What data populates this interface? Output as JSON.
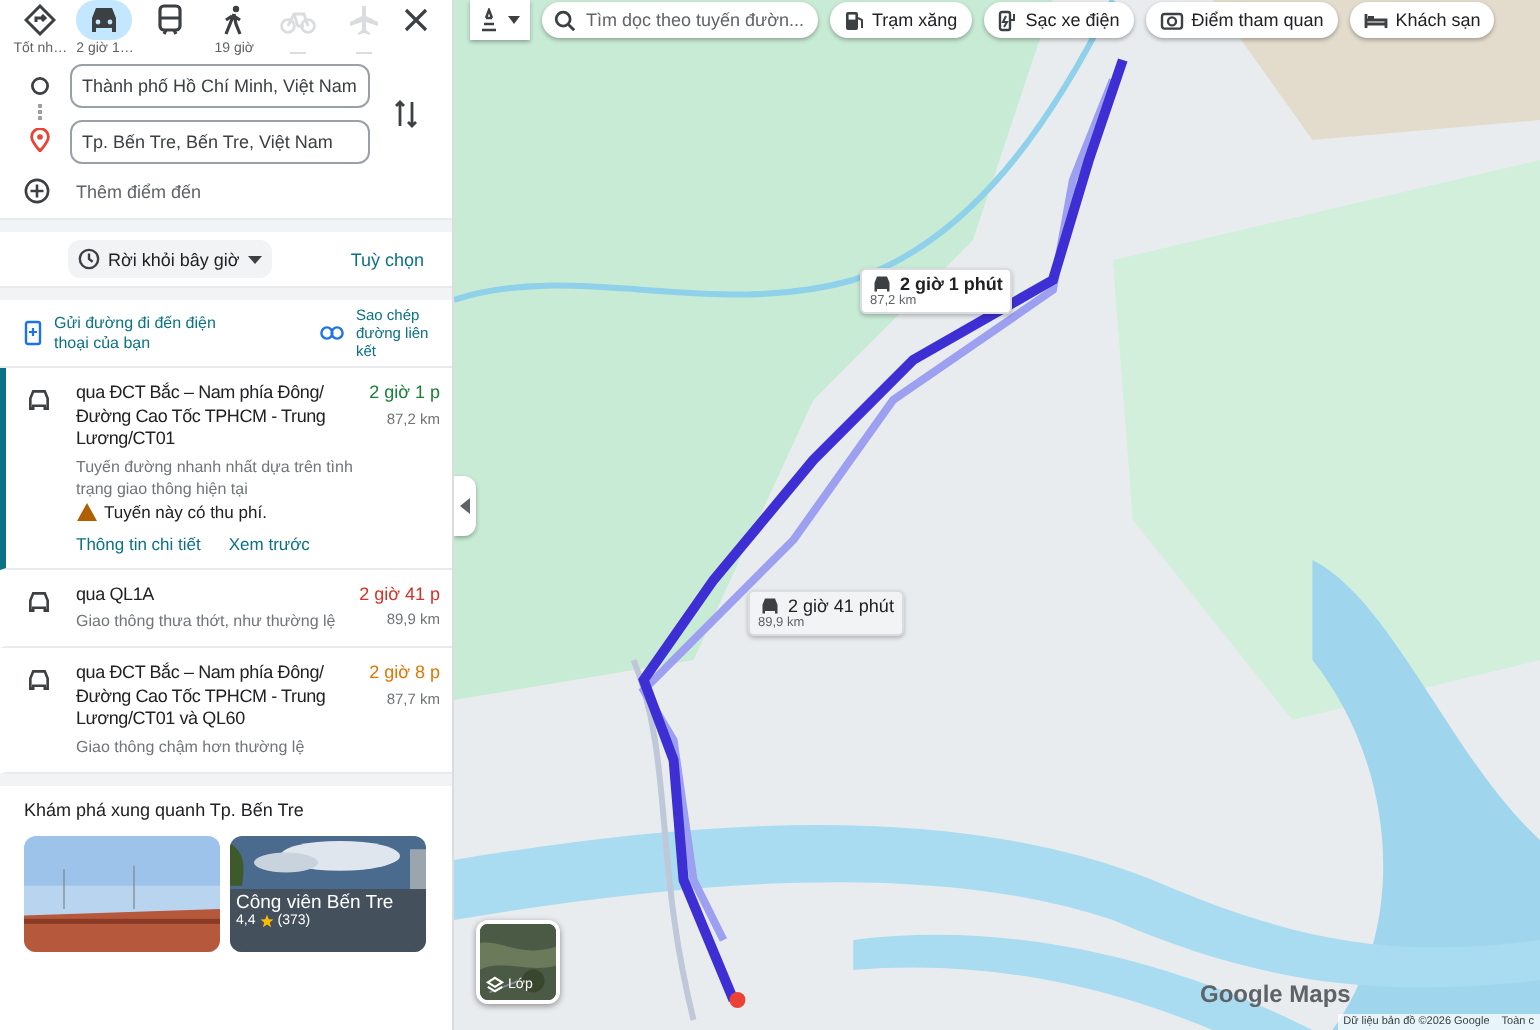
{
  "modes": [
    {
      "kind": "best",
      "label": "Tốt nh…",
      "selected": false,
      "disabled": false
    },
    {
      "kind": "car",
      "label": "2 giờ 1…",
      "selected": true,
      "disabled": false
    },
    {
      "kind": "transit",
      "selected": false,
      "disabled": false
    },
    {
      "kind": "walk",
      "label": "19 giờ",
      "selected": false,
      "disabled": false
    },
    {
      "kind": "bike",
      "selected": false,
      "disabled": true
    },
    {
      "kind": "plane",
      "selected": false,
      "disabled": true
    }
  ],
  "origin": {
    "value": "Thành phố Hồ Chí Minh, Việt Nam"
  },
  "destination": {
    "value": "Tp. Bến Tre, Bến Tre, Việt Nam"
  },
  "add_stop": "Thêm điểm đến",
  "depart": "Rời khỏi bây giờ",
  "options": "Tuỳ chọn",
  "send_to_phone": "Gửi đường đi đến điện thoại của bạn",
  "copy_link": "Sao chép đường liên kết",
  "routes": [
    {
      "title": "qua ĐCT Bắc – Nam phía Đông/ Đường Cao Tốc TPHCM - Trung Lương/CT01",
      "time": "2 giờ 1 p",
      "color": "#188038",
      "distance": "87,2 km",
      "desc": "Tuyến đường nhanh nhất dựa trên tình trạng giao thông hiện tại",
      "warning": "Tuyến này có thu phí.",
      "links": [
        "Thông tin chi tiết",
        "Xem trước"
      ],
      "selected": true
    },
    {
      "title": "qua QL1A",
      "time": "2 giờ 41 p",
      "color": "#d93025",
      "distance": "89,9 km",
      "desc": "Giao thông thưa thớt, như thường lệ",
      "selected": false
    },
    {
      "title": "qua ĐCT Bắc – Nam phía Đông/ Đường Cao Tốc TPHCM - Trung Lương/CT01 và QL60",
      "time": "2 giờ 8 p",
      "color": "#e37400",
      "distance": "87,7 km",
      "desc": "Giao thông chậm hơn thường lệ",
      "selected": false
    }
  ],
  "explore": {
    "title": "Khám phá xung quanh Tp. Bến Tre",
    "cards": [
      {
        "kind": "picture"
      },
      {
        "kind": "picture",
        "name": "Công viên Bến Tre",
        "rating": "4,4",
        "reviews": "(373)"
      }
    ]
  },
  "map": {
    "search": {
      "placeholder": "Tìm dọc theo tuyến đườn..."
    },
    "chips": [
      {
        "kind": "gas",
        "label": "Trạm xăng"
      },
      {
        "kind": "ev",
        "label": "Sạc xe điện"
      },
      {
        "kind": "camera",
        "label": "Điểm tham quan"
      },
      {
        "kind": "hotel",
        "label": "Khách sạn"
      }
    ],
    "callouts": [
      {
        "time": "2 giờ 1 phút",
        "distance": "87,2 km",
        "selected": true
      },
      {
        "time": "2 giờ 41 phút",
        "distance": "89,9 km",
        "selected": false
      }
    ],
    "layers": "Lớp",
    "logo": "Google Maps",
    "attribution": "Dữ liệu bản đồ ©2026 Google",
    "terms": "Toàn c"
  }
}
